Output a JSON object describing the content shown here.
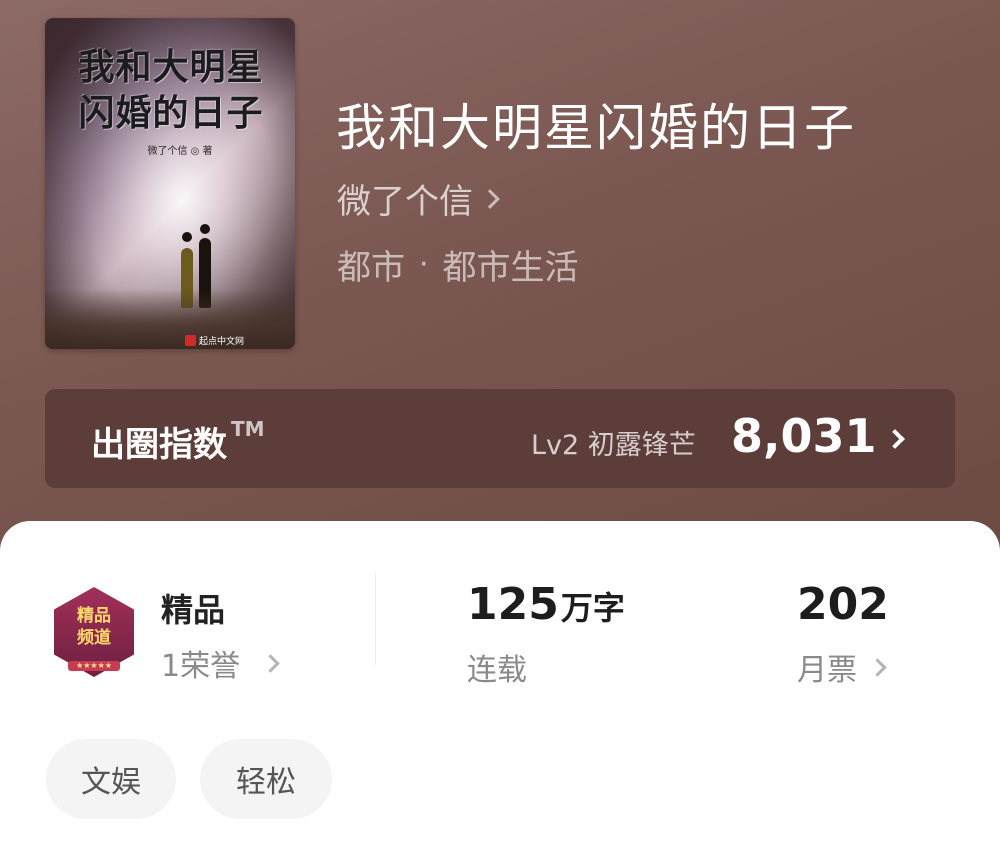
{
  "book": {
    "title": "我和大明星闪婚的日子",
    "author": "微了个信",
    "category": "都市",
    "subcategory": "都市生活",
    "separator": "·"
  },
  "cover": {
    "title_line1": "我和大明星",
    "title_line2": "闪婚的日子",
    "author_line": "微了个信 ◎ 著",
    "publisher": "起点中文网"
  },
  "index_bar": {
    "label": "出圈指数",
    "trademark": "TM",
    "level": "Lv2 初露锋芒",
    "value": "8,031"
  },
  "stats": {
    "quality": {
      "title": "精品",
      "honors": "1荣誉",
      "badge_line1": "精品",
      "badge_line2": "频道",
      "badge_stars": "★★★★★"
    },
    "words": {
      "value": "125",
      "unit": "万字",
      "status": "连载"
    },
    "votes": {
      "value": "202",
      "label": "月票"
    }
  },
  "tags": [
    "文娱",
    "轻松"
  ],
  "colors": {
    "hero_bg": "#7b5751",
    "index_bar_bg": "#5d3d39",
    "panel_bg": "#ffffff",
    "tag_bg": "#f4f4f4",
    "badge": "#a2305a"
  }
}
